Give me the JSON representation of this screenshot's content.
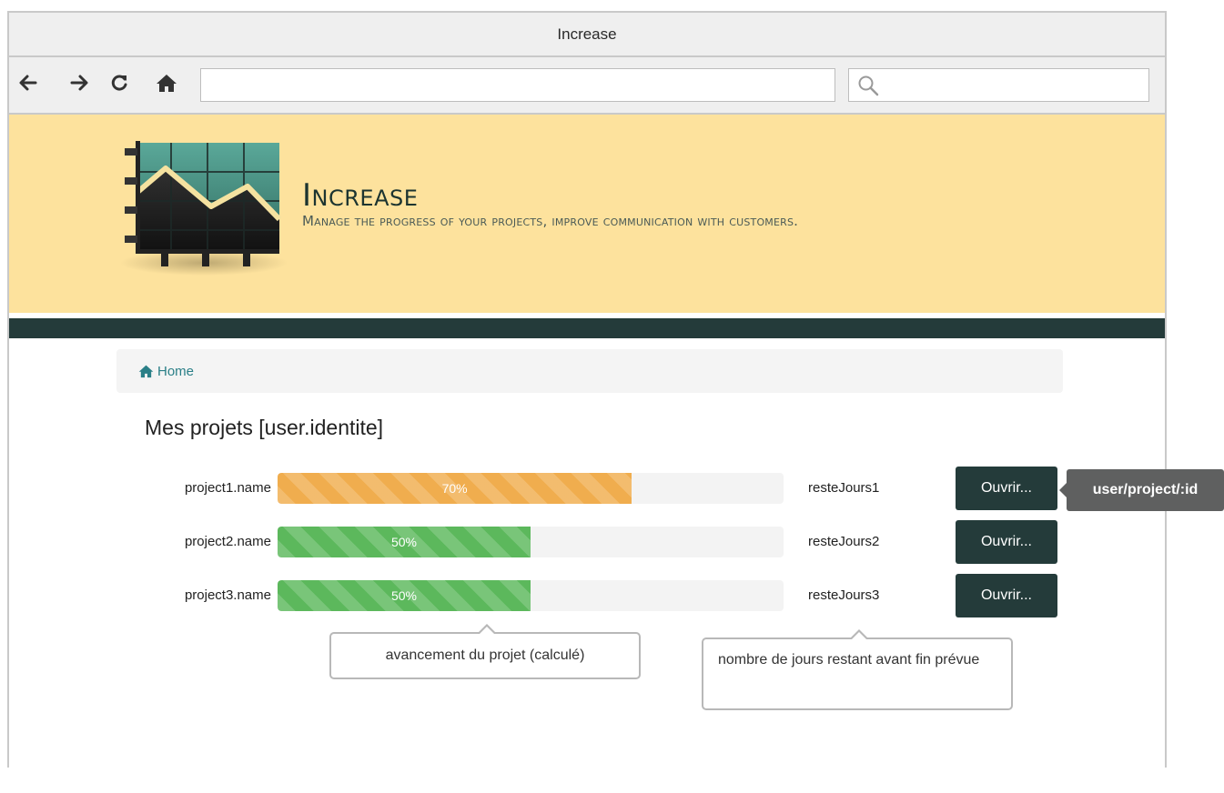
{
  "window": {
    "title": "Increase"
  },
  "browser": {
    "address_value": "",
    "search_value": "",
    "icons": [
      "back-arrow-icon",
      "forward-arrow-icon",
      "reload-icon",
      "home-icon",
      "search-icon"
    ]
  },
  "brand": {
    "title": "Increase",
    "tagline": "Manage the progress of your projects, improve communication with customers."
  },
  "breadcrumb": {
    "home_label": "Home"
  },
  "main": {
    "title": "Mes projets [user.identite]",
    "projects": [
      {
        "name": "project1.name",
        "progress": 70,
        "progress_label": "70%",
        "days_left": "resteJours1",
        "open_label": "Ouvrir...",
        "bar_color": "#f0ad4e"
      },
      {
        "name": "project2.name",
        "progress": 50,
        "progress_label": "50%",
        "days_left": "resteJours2",
        "open_label": "Ouvrir...",
        "bar_color": "#5cb85c"
      },
      {
        "name": "project3.name",
        "progress": 50,
        "progress_label": "50%",
        "days_left": "resteJours3",
        "open_label": "Ouvrir...",
        "bar_color": "#5cb85c"
      }
    ]
  },
  "annotations": {
    "url_tooltip": "user/project/:id",
    "progress_note": "avancement du projet (calculé)",
    "days_note": "nombre de jours restant avant fin prévue"
  },
  "colors": {
    "banner_bg": "#fde29d",
    "dark_band": "#243b3a",
    "button_bg": "#243b3a",
    "link": "#2a7f87",
    "progress_orange": "#f0ad4e",
    "progress_green": "#5cb85c"
  }
}
